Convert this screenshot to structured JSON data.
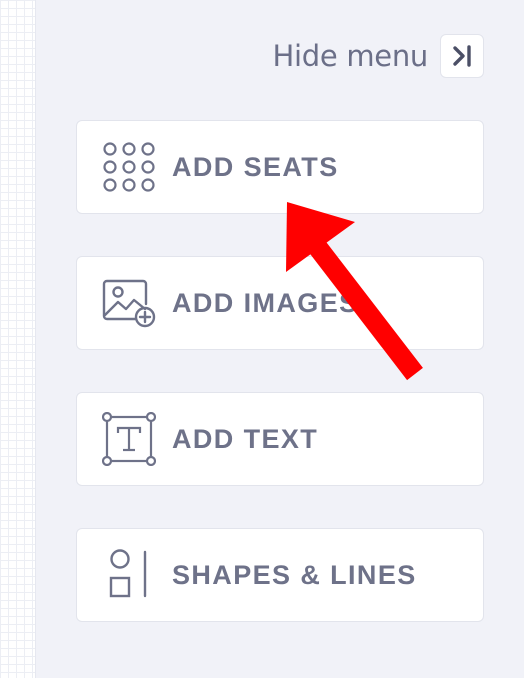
{
  "hide_menu": {
    "label": "Hide menu",
    "icon": "collapse-right-icon"
  },
  "tools": [
    {
      "label": "ADD SEATS",
      "icon": "seat-grid-icon"
    },
    {
      "label": "ADD IMAGES",
      "icon": "add-image-icon"
    },
    {
      "label": "ADD TEXT",
      "icon": "text-box-icon"
    },
    {
      "label": "SHAPES & LINES",
      "icon": "shapes-lines-icon"
    }
  ],
  "colors": {
    "panel_bg": "#f1f2f8",
    "card_bg": "#ffffff",
    "text": "#6e7289",
    "annotation_arrow": "#ff0000"
  },
  "annotation": {
    "type": "arrow",
    "points_to": "ADD SEATS"
  }
}
